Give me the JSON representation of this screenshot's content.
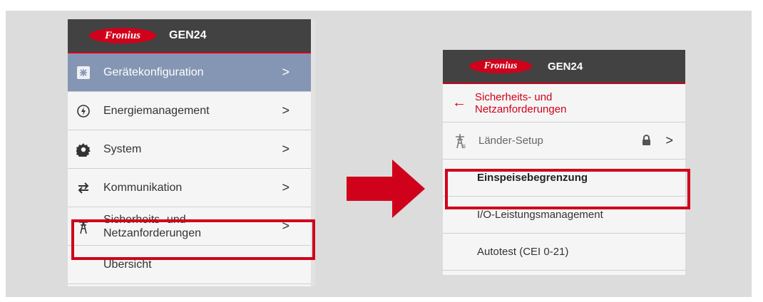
{
  "brand": {
    "logo_text": "Fronius",
    "product": "GEN24",
    "accent_color": "#d0011b",
    "header_color": "#424242"
  },
  "left_menu": {
    "items": [
      {
        "label": "Gerätekonfiguration",
        "icon": "device-config-icon",
        "chevron": ">"
      },
      {
        "label": "Energiemanagement",
        "icon": "energy-icon",
        "chevron": ">"
      },
      {
        "label": "System",
        "icon": "gear-icon",
        "chevron": ">"
      },
      {
        "label": "Kommunikation",
        "icon": "exchange-icon",
        "chevron": ">"
      },
      {
        "label_line1": "Sicherheits- und",
        "label_line2": "Netzanforderungen",
        "icon": "power-pylon-icon",
        "chevron": ">"
      },
      {
        "label": "Übersicht"
      }
    ],
    "active_item": "Gerätekonfiguration"
  },
  "right_menu": {
    "back_label_line1": "Sicherheits- und",
    "back_label_line2": "Netzanforderungen",
    "items": [
      {
        "label": "Länder-Setup",
        "icon": "power-pylon-icon",
        "locked": true,
        "chevron": ">"
      },
      {
        "label": "Einspeisebegrenzung"
      },
      {
        "label": "I/O-Leistungsmanagement"
      },
      {
        "label": "Autotest (CEI 0-21)"
      }
    ]
  }
}
